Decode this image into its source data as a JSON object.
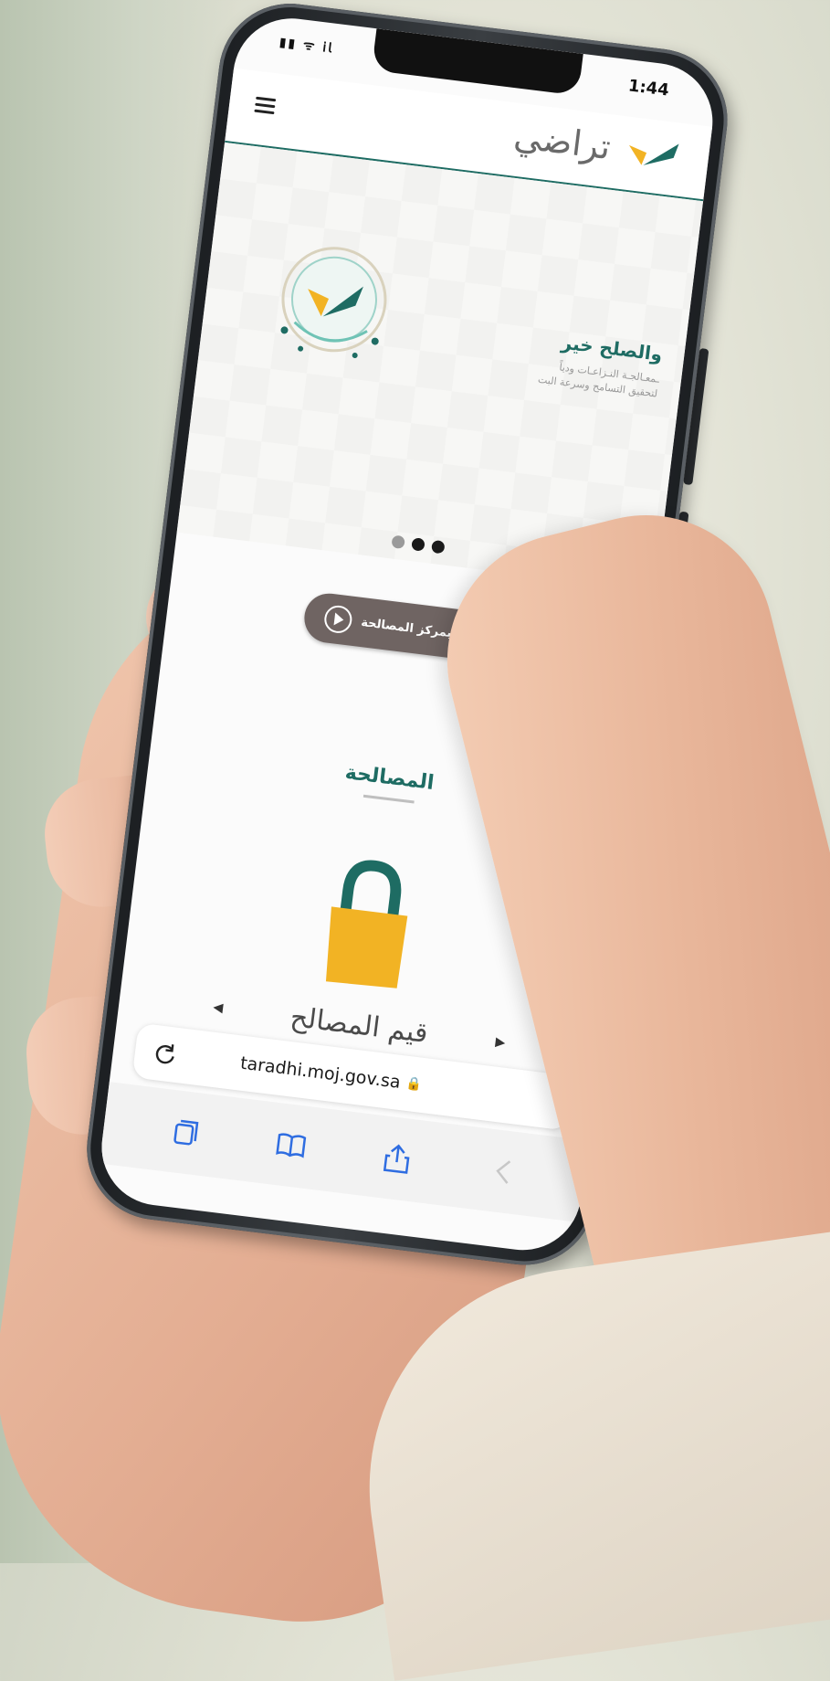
{
  "status_bar": {
    "time": "1:44",
    "signal": "▮▮ ᯤ 𝗂𝗅"
  },
  "header": {
    "brand_name": "تراضي",
    "menu_icon": "hamburger-menu-icon"
  },
  "hero": {
    "title": "والصلح خير",
    "description_line1": "ـمعـالجـة النـزاعـات ودياً",
    "description_line2": "لتحقيق التسامح وسرعة البت"
  },
  "carousel": {
    "total": 3,
    "active_indexes": [
      1,
      2
    ]
  },
  "video_button": {
    "label": "مقطع تعريفي بمركز المصالحة"
  },
  "section": {
    "title": "المصالحة"
  },
  "value_carousel": {
    "label": "قيم المصالح",
    "prev_arrow": "◀",
    "next_arrow": "▶"
  },
  "browser": {
    "url": "taradhi.moj.gov.sa",
    "lock_glyph": "🔒",
    "toolbar": [
      "tabs-icon",
      "bookmarks-icon",
      "share-icon",
      "back-icon"
    ]
  },
  "colors": {
    "brand_green": "#1e6c63",
    "brand_yellow": "#f2b324",
    "button_brown": "#6f6462"
  }
}
